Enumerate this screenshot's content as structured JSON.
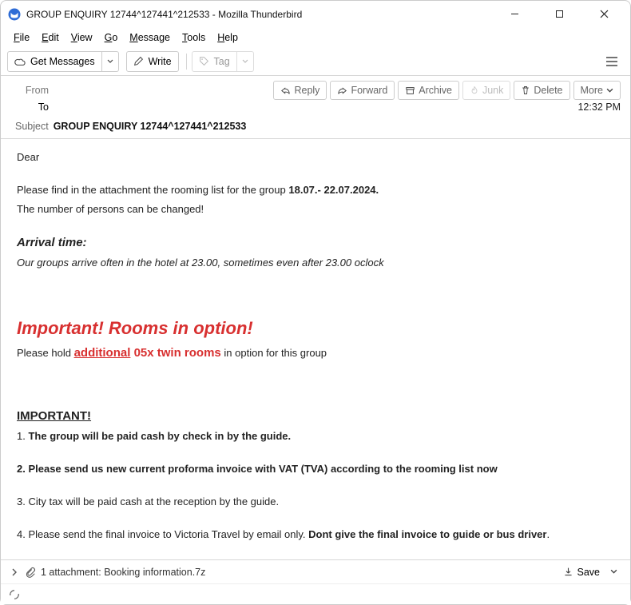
{
  "title": "GROUP ENQUIRY 12744^127441^212533 - Mozilla Thunderbird",
  "menubar": {
    "file": "File",
    "edit": "Edit",
    "view": "View",
    "go": "Go",
    "message": "Message",
    "tools": "Tools",
    "help": "Help"
  },
  "toolbar": {
    "get": "Get Messages",
    "write": "Write",
    "tag": "Tag"
  },
  "header": {
    "from_lbl": "From",
    "to_lbl": "To",
    "subject_lbl": "Subject",
    "subject_val": "GROUP ENQUIRY 12744^127441^212533",
    "time": "12:32 PM"
  },
  "actions": {
    "reply": "Reply",
    "forward": "Forward",
    "archive": "Archive",
    "junk": "Junk",
    "delete": "Delete",
    "more": "More"
  },
  "body": {
    "dear": "Dear",
    "p1a": "Please find in the attachment the rooming list for the group ",
    "p1b": "18.07.- 22.07.2024.",
    "p2": "The number of persons can be changed!",
    "arrival_h": "Arrival time:",
    "arrival_t": "Our groups arrive often in the hotel at 23.00, sometimes even after 23.00 oclock",
    "imp_red": "Important! Rooms in option!",
    "hold_a": "Please hold ",
    "hold_b": "additional",
    "hold_c": " 05x twin rooms",
    "hold_d": " in option for this group",
    "imp2": "IMPORTANT!",
    "l1a": "1. ",
    "l1b": "The group will be paid cash by check in by the guide.",
    "l2": "2. Please send us new current proforma invoice with VAT (TVA) according to the rooming list now",
    "l3": "3. City tax will be paid cash at the reception by the guide.",
    "l4a": "4. Please send the final invoice to Victoria Travel by email only. ",
    "l4b": "Dont give the final invoice to guide or bus driver",
    "l4c": "."
  },
  "attach": {
    "summary": "1 attachment: Booking information.7z",
    "save": "Save"
  }
}
